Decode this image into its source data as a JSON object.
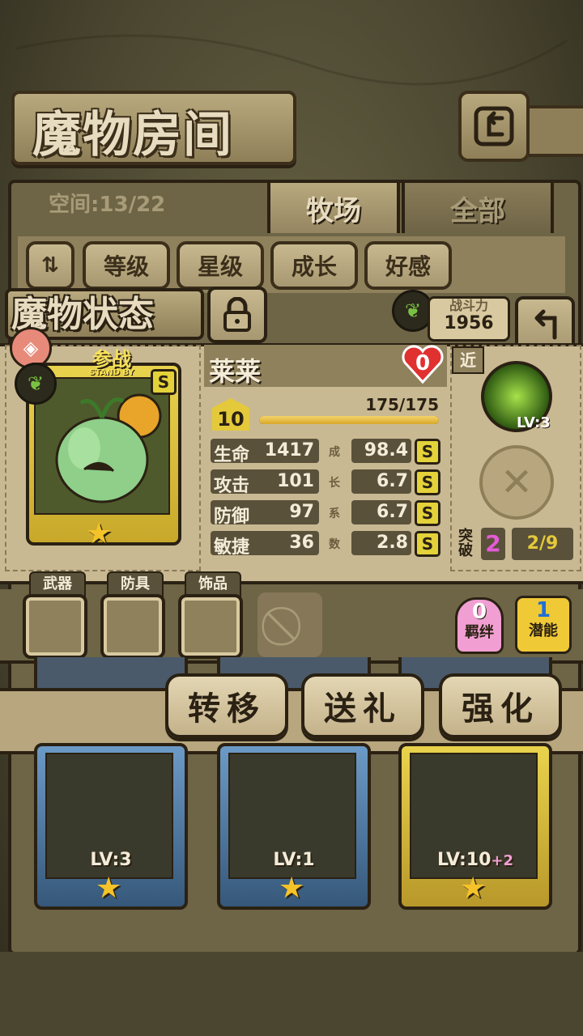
{
  "header": {
    "title": "魔物房间",
    "back_icon": "return-arrow-icon"
  },
  "tabs": {
    "space_label": "空间:13/22",
    "ranch": "牧场",
    "all": "全部"
  },
  "sort": {
    "order_icon": "sort-toggle-icon",
    "level": "等级",
    "star": "星级",
    "growth": "成长",
    "affection": "好感"
  },
  "status": {
    "title": "魔物状态",
    "lock_icon": "padlock-icon",
    "power_label": "战斗力",
    "power_value": "1956"
  },
  "card": {
    "standby_cn": "参战",
    "standby_en": "STAND BY",
    "rank": "S",
    "type_icon": "leaf-icon",
    "stars": 1
  },
  "monster": {
    "name": "莱莱",
    "affection": "0",
    "level": "10",
    "hp_text": "175/175",
    "hp_fraction": 1.0,
    "growth_label_chars": [
      "成",
      "长",
      "系",
      "数"
    ],
    "stats": [
      {
        "label": "生命",
        "value": "1417",
        "growth": "98.4",
        "rank": "S"
      },
      {
        "label": "攻击",
        "value": "101",
        "growth": "6.7",
        "rank": "S"
      },
      {
        "label": "防御",
        "value": "97",
        "growth": "6.7",
        "rank": "S"
      },
      {
        "label": "敏捷",
        "value": "36",
        "growth": "2.8",
        "rank": "S"
      }
    ]
  },
  "skills": {
    "range": "近",
    "skill_lv": "LV:3",
    "break_label": "突破",
    "break_value": "2",
    "break_progress": "2/9"
  },
  "equipment": {
    "weapon": "武器",
    "armor": "防具",
    "accessory": "饰品"
  },
  "badges": {
    "bond_value": "0",
    "bond_label": "羁绊",
    "potential_value": "1",
    "potential_label": "潜能"
  },
  "actions": {
    "transfer": "转移",
    "gift": "送礼",
    "enhance": "强化"
  },
  "roster": [
    {
      "lv": "LV:3",
      "plus": "",
      "color": "#36587a"
    },
    {
      "lv": "LV:1",
      "plus": "",
      "color": "#36587a"
    },
    {
      "lv": "LV:10",
      "plus": "+2",
      "color": "#c8a82a"
    }
  ],
  "colors": {
    "gold": "#e9d34d",
    "panel": "#c9b993",
    "dark": "#2a2113",
    "pink": "#e35bd6"
  }
}
